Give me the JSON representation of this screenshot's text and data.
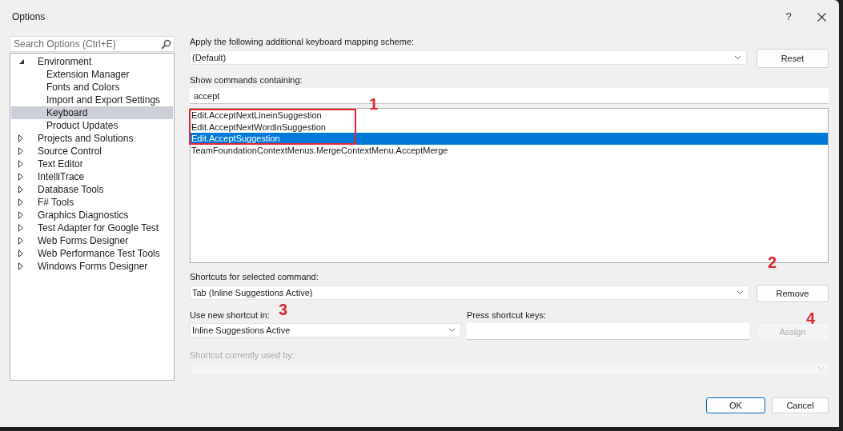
{
  "window": {
    "title": "Options",
    "help": "?"
  },
  "search": {
    "placeholder": "Search Options (Ctrl+E)"
  },
  "tree": [
    {
      "label": "Environment",
      "expanded": true,
      "selected": false,
      "children": [
        {
          "label": "Extension Manager",
          "selected": false
        },
        {
          "label": "Fonts and Colors",
          "selected": false
        },
        {
          "label": "Import and Export Settings",
          "selected": false
        },
        {
          "label": "Keyboard",
          "selected": true
        },
        {
          "label": "Product Updates",
          "selected": false
        }
      ]
    },
    {
      "label": "Projects and Solutions",
      "expanded": false,
      "selected": false
    },
    {
      "label": "Source Control",
      "expanded": false,
      "selected": false
    },
    {
      "label": "Text Editor",
      "expanded": false,
      "selected": false
    },
    {
      "label": "IntelliTrace",
      "expanded": false,
      "selected": false
    },
    {
      "label": "Database Tools",
      "expanded": false,
      "selected": false
    },
    {
      "label": "F# Tools",
      "expanded": false,
      "selected": false
    },
    {
      "label": "Graphics Diagnostics",
      "expanded": false,
      "selected": false
    },
    {
      "label": "Test Adapter for Google Test",
      "expanded": false,
      "selected": false
    },
    {
      "label": "Web Forms Designer",
      "expanded": false,
      "selected": false
    },
    {
      "label": "Web Performance Test Tools",
      "expanded": false,
      "selected": false
    },
    {
      "label": "Windows Forms Designer",
      "expanded": false,
      "selected": false
    }
  ],
  "mapping_scheme": {
    "label": "Apply the following additional keyboard mapping scheme:",
    "value": "(Default)"
  },
  "reset_button": {
    "label": "Reset",
    "disabled": false
  },
  "commands_filter": {
    "label": "Show commands containing:",
    "value": "accept"
  },
  "commands": [
    {
      "label": "Edit.AcceptNextLineinSuggestion",
      "selected": false
    },
    {
      "label": "Edit.AcceptNextWordinSuggestion",
      "selected": false
    },
    {
      "label": "Edit.AcceptSuggestion",
      "selected": true
    },
    {
      "label": "TeamFoundationContextMenus.MergeContextMenu.AcceptMerge",
      "selected": false
    }
  ],
  "shortcuts": {
    "label": "Shortcuts for selected command:",
    "value": "Tab (Inline Suggestions Active)"
  },
  "remove_button": {
    "label": "Remove",
    "disabled": false
  },
  "use_in": {
    "label": "Use new shortcut in:",
    "value": "Inline Suggestions Active"
  },
  "press_keys": {
    "label": "Press shortcut keys:"
  },
  "assign_button": {
    "label": "Assign",
    "disabled": true
  },
  "used_by": {
    "label": "Shortcut currently used by:",
    "disabled": true
  },
  "ok_button": {
    "label": "OK"
  },
  "cancel_button": {
    "label": "Cancel"
  },
  "callouts": [
    {
      "label": "1"
    },
    {
      "label": "2"
    },
    {
      "label": "3"
    },
    {
      "label": "4"
    }
  ]
}
